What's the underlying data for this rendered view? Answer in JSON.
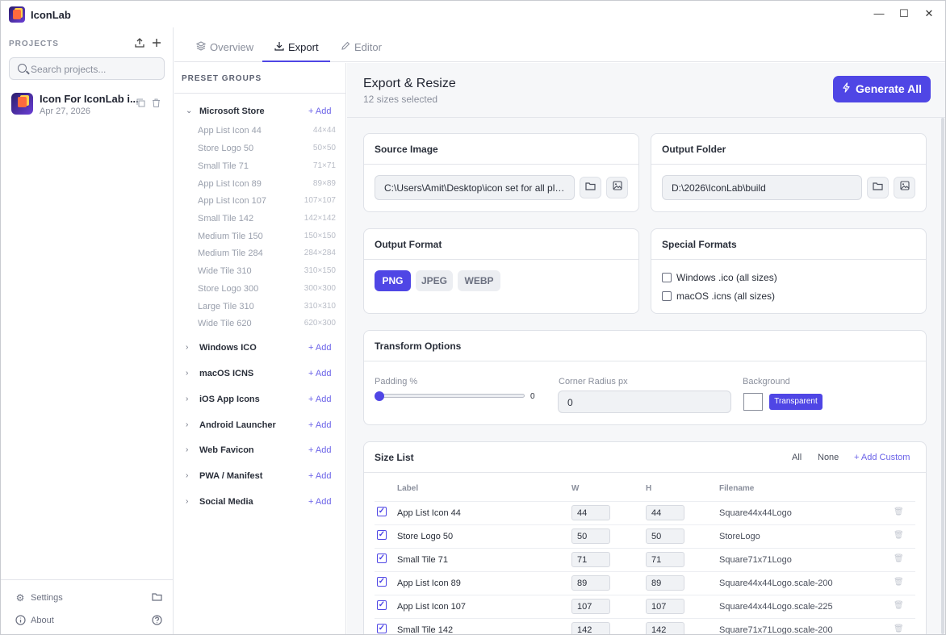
{
  "app": {
    "title": "IconLab"
  },
  "window_controls": {
    "minimize": "—",
    "maximize": "☐",
    "close": "✕"
  },
  "sidebar": {
    "title": "PROJECTS",
    "search_placeholder": "Search projects...",
    "project": {
      "name": "Icon For IconLab i...",
      "date": "Apr 27, 2026"
    },
    "footer": {
      "settings": "Settings",
      "about": "About"
    }
  },
  "tabs": [
    {
      "label": "Overview",
      "icon": "layers-icon"
    },
    {
      "label": "Export",
      "icon": "download-icon",
      "active": true
    },
    {
      "label": "Editor",
      "icon": "pencil-icon"
    }
  ],
  "presets": {
    "title": "PRESET GROUPS",
    "add_label": "+ Add",
    "groups": [
      {
        "name": "Microsoft Store",
        "expanded": true,
        "chevron": "⌄"
      },
      {
        "name": "Windows ICO",
        "chevron": "›"
      },
      {
        "name": "macOS ICNS",
        "chevron": "›"
      },
      {
        "name": "iOS App Icons",
        "chevron": "›"
      },
      {
        "name": "Android Launcher",
        "chevron": "›"
      },
      {
        "name": "Web Favicon",
        "chevron": "›"
      },
      {
        "name": "PWA / Manifest",
        "chevron": "›"
      },
      {
        "name": "Social Media",
        "chevron": "›"
      }
    ],
    "items": [
      {
        "name": "App List Icon 44",
        "size": "44×44"
      },
      {
        "name": "Store Logo 50",
        "size": "50×50"
      },
      {
        "name": "Small Tile 71",
        "size": "71×71"
      },
      {
        "name": "App List Icon 89",
        "size": "89×89"
      },
      {
        "name": "App List Icon 107",
        "size": "107×107"
      },
      {
        "name": "Small Tile 142",
        "size": "142×142"
      },
      {
        "name": "Medium Tile 150",
        "size": "150×150"
      },
      {
        "name": "Medium Tile 284",
        "size": "284×284"
      },
      {
        "name": "Wide Tile 310",
        "size": "310×150"
      },
      {
        "name": "Store Logo 300",
        "size": "300×300"
      },
      {
        "name": "Large Tile 310",
        "size": "310×310"
      },
      {
        "name": "Wide Tile 620",
        "size": "620×300"
      }
    ]
  },
  "main": {
    "title": "Export & Resize",
    "subtitle": "12 sizes selected",
    "generate_label": "Generate All",
    "source": {
      "title": "Source Image",
      "path": "C:\\Users\\Amit\\Desktop\\icon set for all pla..."
    },
    "output": {
      "title": "Output Folder",
      "path": "D:\\2026\\IconLab\\build"
    },
    "format": {
      "title": "Output Format",
      "options": [
        "PNG",
        "JPEG",
        "WEBP"
      ],
      "selected": "PNG"
    },
    "special": {
      "title": "Special Formats",
      "ico": "Windows .ico (all sizes)",
      "icns": "macOS .icns (all sizes)"
    },
    "transform": {
      "title": "Transform Options",
      "padding_label": "Padding %",
      "padding_value": "0",
      "radius_label": "Corner Radius px",
      "radius_value": "0",
      "background_label": "Background",
      "transparent_label": "Transparent"
    },
    "sizelist": {
      "title": "Size List",
      "all": "All",
      "none": "None",
      "add_custom": "+ Add Custom",
      "headers": {
        "label": "Label",
        "w": "W",
        "h": "H",
        "filename": "Filename"
      },
      "rows": [
        {
          "label": "App List Icon 44",
          "w": "44",
          "h": "44",
          "file": "Square44x44Logo"
        },
        {
          "label": "Store Logo 50",
          "w": "50",
          "h": "50",
          "file": "StoreLogo"
        },
        {
          "label": "Small Tile 71",
          "w": "71",
          "h": "71",
          "file": "Square71x71Logo"
        },
        {
          "label": "App List Icon 89",
          "w": "89",
          "h": "89",
          "file": "Square44x44Logo.scale-200"
        },
        {
          "label": "App List Icon 107",
          "w": "107",
          "h": "107",
          "file": "Square44x44Logo.scale-225"
        },
        {
          "label": "Small Tile 142",
          "w": "142",
          "h": "142",
          "file": "Square71x71Logo.scale-200"
        }
      ]
    }
  },
  "colors": {
    "accent": "#4f46e5",
    "link": "#6b63e8"
  }
}
